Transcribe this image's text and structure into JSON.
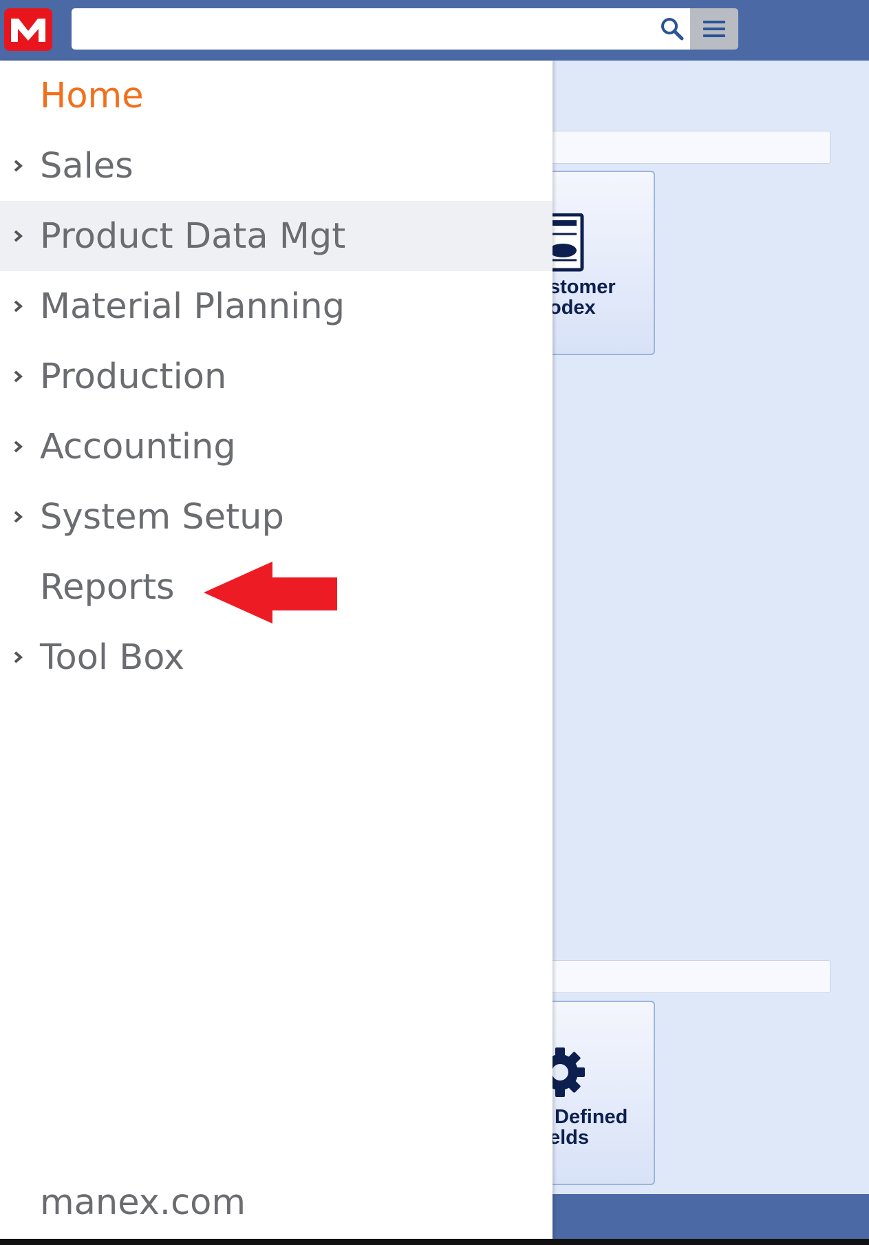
{
  "header": {
    "logo_letter": "M",
    "search": {
      "value": "",
      "placeholder": ""
    },
    "icons": {
      "search": "search-icon",
      "menu": "hamburger-icon"
    }
  },
  "sidebar": {
    "items": [
      {
        "label": "Home",
        "active": true,
        "has_chevron": false
      },
      {
        "label": "Sales",
        "has_chevron": true
      },
      {
        "label": "Product Data Mgt",
        "has_chevron": true,
        "highlighted": true
      },
      {
        "label": "Material Planning",
        "has_chevron": true
      },
      {
        "label": "Production",
        "has_chevron": true
      },
      {
        "label": "Accounting",
        "has_chevron": true
      },
      {
        "label": "System Setup",
        "has_chevron": true
      },
      {
        "label": "Reports",
        "has_chevron": false
      },
      {
        "label": "Tool Box",
        "has_chevron": true
      }
    ],
    "footer": "manex.com"
  },
  "background": {
    "tiles": [
      {
        "line1": "stomer",
        "line2": "odex",
        "icon": "report-document-icon"
      },
      {
        "line1": " Defined",
        "line2": "elds",
        "icon": "gear-icon"
      }
    ]
  },
  "annotation": {
    "arrow_color": "#ed1c24",
    "points_to": "Reports"
  },
  "colors": {
    "topbar": "#4b69a4",
    "logo": "#e8161c",
    "active_menu": "#f26f1c",
    "menu_text": "#6a6c70",
    "content_bg": "#dfe8f8"
  }
}
